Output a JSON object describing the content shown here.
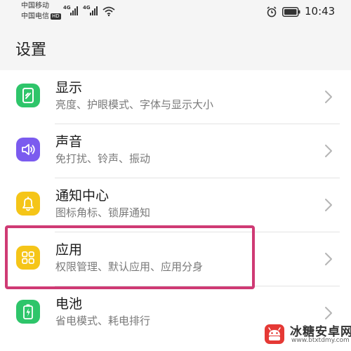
{
  "status_bar": {
    "carrier_1": "中国移动",
    "carrier_2": "中国电信",
    "hd_badge": "HD",
    "network_1": "4G",
    "network_2": "4G",
    "time": "10:43"
  },
  "header": {
    "title": "设置"
  },
  "settings": [
    {
      "title": "显示",
      "subtitle": "亮度、护眼模式、字体与显示大小",
      "icon": "display-icon",
      "icon_color": "#2ec56a"
    },
    {
      "title": "声音",
      "subtitle": "免打扰、铃声、振动",
      "icon": "speaker-icon",
      "icon_color": "#7b5bef"
    },
    {
      "title": "通知中心",
      "subtitle": "图标角标、锁屏通知",
      "icon": "bell-icon",
      "icon_color": "#f5c518"
    },
    {
      "title": "应用",
      "subtitle": "权限管理、默认应用、应用分身",
      "icon": "apps-grid-icon",
      "icon_color": "#f5c518"
    },
    {
      "title": "电池",
      "subtitle": "省电模式、耗电排行",
      "icon": "battery-charging-icon",
      "icon_color": "#2ec56a"
    }
  ],
  "highlight": {
    "color": "#cf3a74",
    "target": "应用"
  },
  "watermark": {
    "title": "冰糖安卓网",
    "url": "www.btxtdmy.com"
  }
}
